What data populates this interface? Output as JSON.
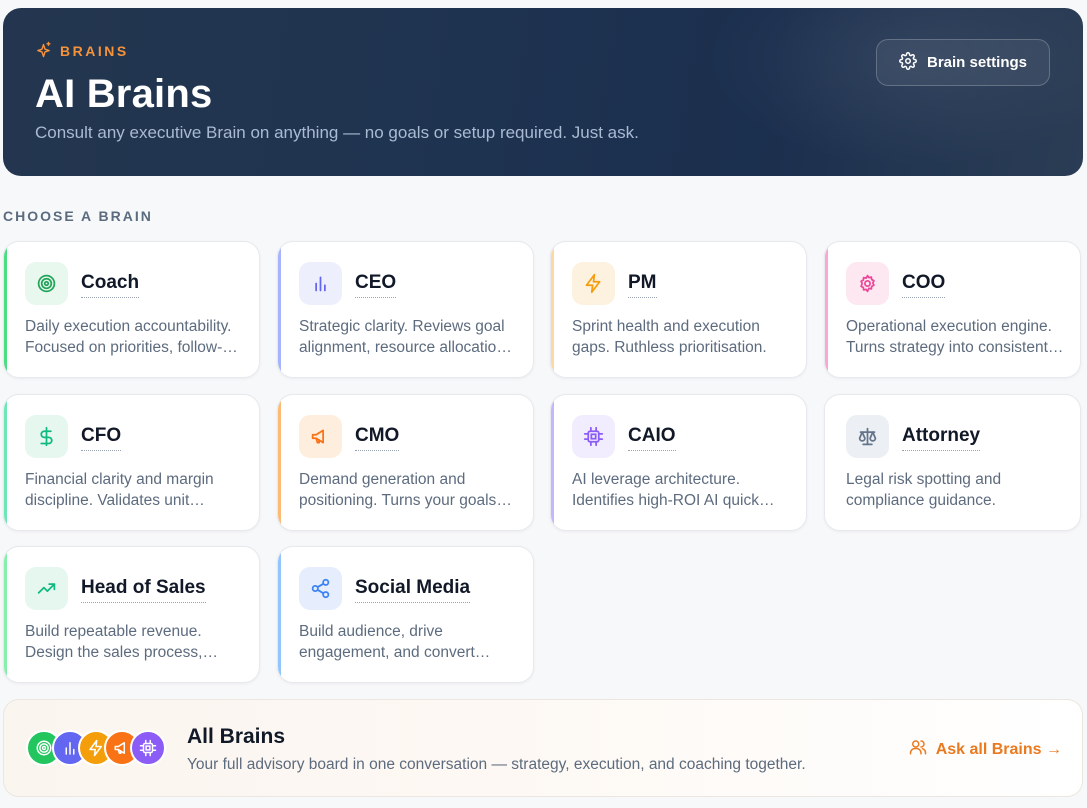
{
  "header": {
    "eyebrow": "BRAINS",
    "title": "AI Brains",
    "subtitle": "Consult any executive Brain on anything — no goals or setup required. Just ask.",
    "settings_label": "Brain settings"
  },
  "section_label": "CHOOSE A BRAIN",
  "brains": [
    {
      "name": "Coach",
      "description": "Daily execution accountability. Focused on priorities, follow-through and consistency.",
      "icon": "target-icon",
      "accent": "#22c55e"
    },
    {
      "name": "CEO",
      "description": "Strategic clarity. Reviews goal alignment, resource allocation and direction.",
      "icon": "bar-chart-icon",
      "accent": "#6366f1"
    },
    {
      "name": "PM",
      "description": "Sprint health and execution gaps. Ruthless prioritisation.",
      "icon": "lightning-icon",
      "accent": "#f59e0b"
    },
    {
      "name": "COO",
      "description": "Operational execution engine. Turns strategy into consistent operations.",
      "icon": "gear-icon",
      "accent": "#ec4899"
    },
    {
      "name": "CFO",
      "description": "Financial clarity and margin discipline. Validates unit economics.",
      "icon": "dollar-icon",
      "accent": "#10b981"
    },
    {
      "name": "CMO",
      "description": "Demand generation and positioning. Turns your goals into growth.",
      "icon": "megaphone-icon",
      "accent": "#f97316"
    },
    {
      "name": "CAIO",
      "description": "AI leverage architecture. Identifies high-ROI AI quick wins.",
      "icon": "chip-icon",
      "accent": "#8b5cf6"
    },
    {
      "name": "Attorney",
      "description": "Legal risk spotting and compliance guidance.",
      "icon": "scales-icon",
      "accent": "#64748b"
    },
    {
      "name": "Head of Sales",
      "description": "Build repeatable revenue. Design the sales process, pipeline and close.",
      "icon": "trend-up-icon",
      "accent": "#10b981"
    },
    {
      "name": "Social Media",
      "description": "Build audience, drive engagement, and convert followers.",
      "icon": "share-icon",
      "accent": "#3b82f6"
    }
  ],
  "all_brains": {
    "title": "All Brains",
    "subtitle": "Your full advisory board in one conversation — strategy, execution, and coaching together.",
    "cta": "Ask all Brains →"
  }
}
